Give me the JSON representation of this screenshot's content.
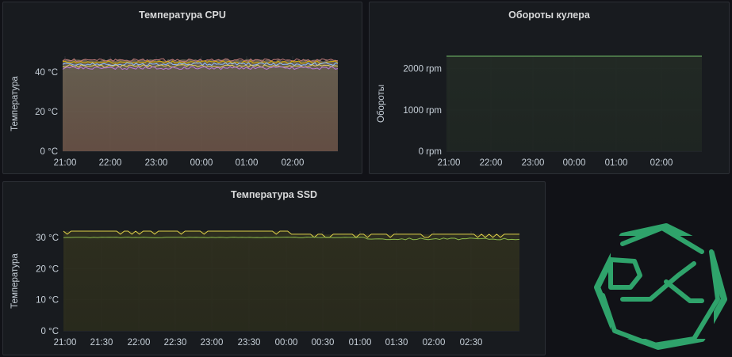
{
  "panels": [
    {
      "title": "Температура CPU",
      "ylabel": "Температура",
      "yticks": [
        "0 °C",
        "20 °C",
        "40 °C"
      ],
      "xticks": [
        "21:00",
        "22:00",
        "23:00",
        "00:00",
        "01:00",
        "02:00"
      ]
    },
    {
      "title": "Обороты кулера",
      "ylabel": "Обороты",
      "yticks": [
        "0 rpm",
        "1000 rpm",
        "2000 rpm"
      ],
      "xticks": [
        "21:00",
        "22:00",
        "23:00",
        "00:00",
        "01:00",
        "02:00"
      ]
    },
    {
      "title": "Температура SSD",
      "ylabel": "Температура",
      "yticks": [
        "0 °C",
        "10 °C",
        "20 °C",
        "30 °C"
      ],
      "xticks": [
        "21:00",
        "21:30",
        "22:00",
        "22:30",
        "23:00",
        "23:30",
        "00:00",
        "00:30",
        "01:00",
        "01:30",
        "02:00",
        "02:30"
      ]
    }
  ],
  "chart_data": [
    {
      "type": "area",
      "title": "Температура CPU",
      "ylabel": "Температура",
      "unit": "°C",
      "ylim": [
        0,
        48
      ],
      "x": [
        "21:00",
        "22:00",
        "23:00",
        "00:00",
        "01:00",
        "02:00"
      ],
      "series": [
        {
          "values": [
            46,
            46,
            46,
            46,
            46,
            46
          ],
          "color": "#c07a7a"
        },
        {
          "values": [
            45,
            45,
            45,
            45,
            45,
            45
          ],
          "color": "#e0b400"
        },
        {
          "values": [
            44,
            44,
            44,
            44,
            44,
            44
          ],
          "color": "#8ab8ff"
        },
        {
          "values": [
            43,
            43,
            43,
            43,
            43,
            43
          ],
          "color": "#e8d060"
        },
        {
          "values": [
            42,
            42,
            42,
            42,
            42,
            42
          ],
          "color": "#b877d9"
        }
      ],
      "grid": true
    },
    {
      "type": "area",
      "title": "Обороты кулера",
      "ylabel": "Обороты",
      "unit": "rpm",
      "ylim": [
        0,
        2300
      ],
      "x": [
        "21:00",
        "22:00",
        "23:00",
        "00:00",
        "01:00",
        "02:00"
      ],
      "series": [
        {
          "values": [
            2300,
            2300,
            2300,
            2300,
            2300,
            2300
          ],
          "color": "#73bf69"
        }
      ],
      "grid": true
    },
    {
      "type": "area",
      "title": "Температура SSD",
      "ylabel": "Температура",
      "unit": "°C",
      "ylim": [
        0,
        32
      ],
      "x": [
        "21:00",
        "21:30",
        "22:00",
        "22:30",
        "23:00",
        "23:30",
        "00:00",
        "00:30",
        "01:00",
        "01:30",
        "02:00",
        "02:30"
      ],
      "series": [
        {
          "values": [
            32,
            32,
            32,
            32,
            32,
            32,
            31,
            31,
            31,
            31,
            31,
            31
          ],
          "color": "#e0d24a"
        },
        {
          "values": [
            30,
            30,
            30,
            30,
            30,
            30,
            30,
            30,
            29.5,
            29.5,
            29.5,
            29.5
          ],
          "color": "#8ab84a"
        }
      ],
      "grid": true
    }
  ],
  "logo": {
    "icon": "pk-logo-icon",
    "color": "#2fa36b"
  }
}
